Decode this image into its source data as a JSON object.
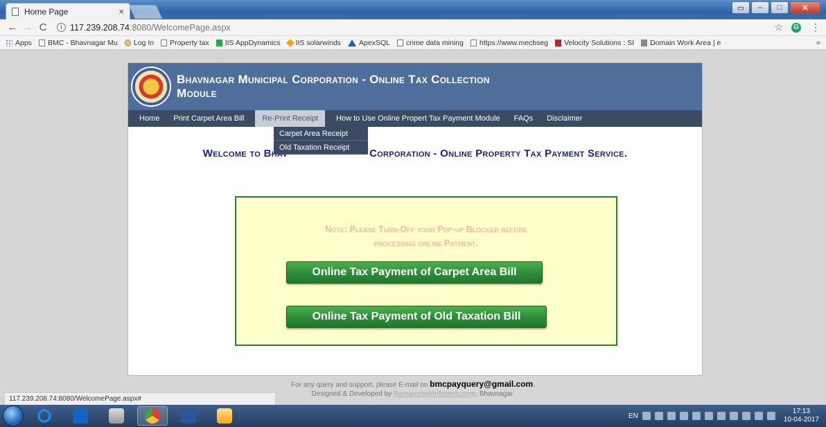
{
  "browser": {
    "tab_title": "Home Page",
    "tab_close": "×",
    "url_host": "117.239.208.74",
    "url_rest": ":8080/WelcomePage.aspx",
    "bookmarks": [
      {
        "label": "Apps",
        "icon": "apps-grid-icon"
      },
      {
        "label": "BMC - Bhavnagar Mu",
        "icon": "page-icon"
      },
      {
        "label": "Log In",
        "icon": "globe-icon"
      },
      {
        "label": "Property tax",
        "icon": "page-icon"
      },
      {
        "label": "IIS AppDynamics",
        "icon": "appdynamics-icon"
      },
      {
        "label": "IIS solarwinds",
        "icon": "solarwinds-icon"
      },
      {
        "label": "ApexSQL",
        "icon": "apexsql-icon"
      },
      {
        "label": "crime data mining",
        "icon": "page-icon"
      },
      {
        "label": "https://www.mecbseg",
        "icon": "page-icon"
      },
      {
        "label": "Velocity Solutions : SI",
        "icon": "velocity-icon"
      },
      {
        "label": "Domain Work Area | e",
        "icon": "domain-icon"
      }
    ],
    "bookmarks_more": "»",
    "status_url": "117.239.208.74:8080/WelcomePage.aspx#"
  },
  "site": {
    "title_line1": "Bhavnagar Municipal Corporation - Online Tax Collection",
    "title_line2": "Module",
    "menu": [
      "Home",
      "Print Carpet Area Bill",
      "Re-Print Receipt",
      "How to Use Online Propert Tax Payment Module",
      "FAQs",
      "Disclaimer"
    ],
    "active_menu": "Re-Print Receipt",
    "dropdown": [
      "Carpet Area Receipt",
      "Old Taxation Receipt"
    ],
    "welcome_left": "Welcome to Bhav",
    "welcome_right": "Corporation - Online Property Tax Payment Service.",
    "note": "Note: Please Turn-Off your Pop-up Blocker before processing online Payment.",
    "btn_carpet": "Online Tax Payment of Carpet Area Bill",
    "btn_old": "Online Tax Payment of Old Taxation Bill",
    "footer_line1_prefix": "For any query and support, please E-mail on ",
    "footer_email": "bmcpayquery@gmail.com",
    "footer_line1_suffix": ".",
    "footer_line2_prefix": "Designed & Developed by ",
    "footer_dev": "RamansheeInfotech.com",
    "footer_line2_suffix": ", Bhavnagar."
  },
  "taskbar": {
    "lang": "EN",
    "time": "17:13",
    "date": "10-04-2017"
  },
  "colors": {
    "banner": "#4f6e9b",
    "menubar": "#3a4b63",
    "welcome_text": "#1a237e",
    "note_box_bg": "#ffffcc",
    "note_box_border": "#2e7d32",
    "button_green": "#2e8b3a"
  }
}
